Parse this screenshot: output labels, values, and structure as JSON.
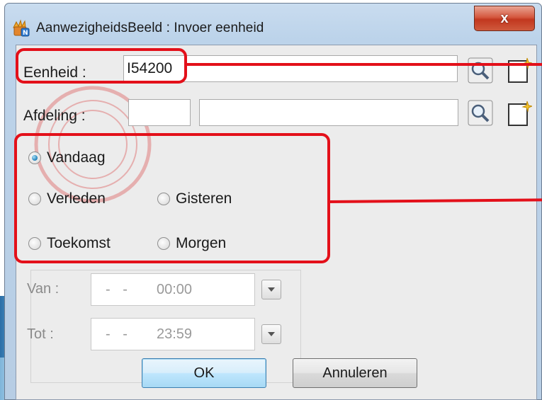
{
  "window": {
    "title": "AanwezigheidsBeeld : Invoer eenheid",
    "close_label": "x"
  },
  "form": {
    "eenheid_label": "Eenheid :",
    "eenheid_value": "I54200",
    "afdeling_label": "Afdeling :",
    "afdeling_code": "",
    "afdeling_name": ""
  },
  "period": {
    "options": [
      {
        "label": "Vandaag",
        "selected": true
      },
      {
        "label": "Verleden",
        "selected": false
      },
      {
        "label": "Gisteren",
        "selected": false
      },
      {
        "label": "Toekomst",
        "selected": false
      },
      {
        "label": "Morgen",
        "selected": false
      }
    ]
  },
  "range": {
    "van_label": "Van :",
    "van_date": "- -",
    "van_time": "00:00",
    "tot_label": "Tot :",
    "tot_date": "- -",
    "tot_time": "23:59"
  },
  "buttons": {
    "ok_label": "OK",
    "cancel_label": "Annuleren"
  },
  "colors": {
    "annotation": "#e3101a",
    "close_button": "#c2371f",
    "radio_selected": "#1f7fb9"
  },
  "icons": [
    "app-icon",
    "search-icon",
    "new-record-icon",
    "close-icon",
    "dropdown-arrow-icon"
  ]
}
